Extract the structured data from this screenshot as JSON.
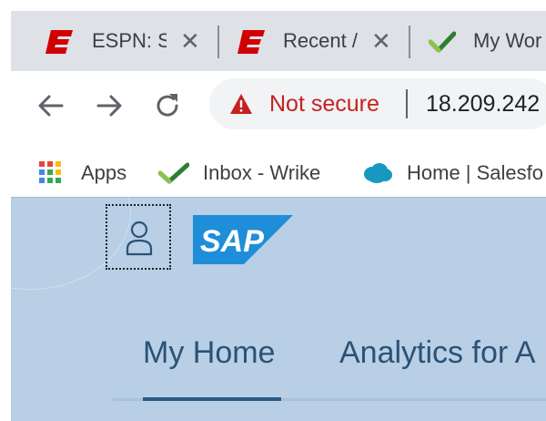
{
  "tabs": [
    {
      "label": "ESPN: S",
      "close": "✕",
      "icon": "espn-icon"
    },
    {
      "label": "Recent /",
      "close": "✕",
      "icon": "espn-icon"
    },
    {
      "label": "My Wor",
      "icon": "wrike-check-icon"
    }
  ],
  "toolbar": {
    "security_label": "Not secure",
    "url": "18.209.242"
  },
  "bookmarks": [
    {
      "label": "Apps",
      "icon": "apps-grid-icon"
    },
    {
      "label": "Inbox - Wrike",
      "icon": "wrike-check-icon"
    },
    {
      "label": "Home | Salesfo",
      "icon": "salesforce-cloud-icon"
    }
  ],
  "sap": {
    "logo_text": "SAP",
    "nav_tabs": [
      "My Home",
      "Analytics for A"
    ]
  },
  "colors": {
    "not_secure_red": "#c5221f",
    "sap_background": "#b8cfe6",
    "sap_tab_text": "#2b5276",
    "sap_logo_blue": "#1f8ed8",
    "espn_red": "#d00"
  }
}
